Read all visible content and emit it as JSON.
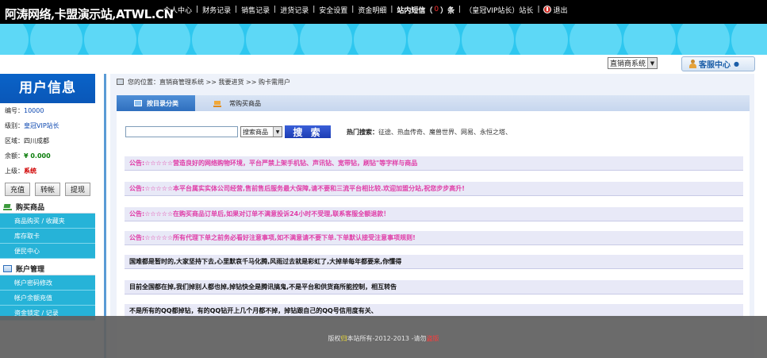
{
  "header": {
    "site_title_cn": "阿涛网络,卡盟演示站,",
    "site_title_en": "ATWL.CN",
    "nav": [
      {
        "label": "个人中心"
      },
      {
        "label": "财务记录"
      },
      {
        "label": "销售记录"
      },
      {
        "label": "进货记录"
      },
      {
        "label": "安全设置"
      },
      {
        "label": "资金明细"
      }
    ],
    "messages": {
      "prefix": "站内短信（",
      "count": "0",
      "suffix": "）条"
    },
    "user_role": "（皇冠VIP站长）站长",
    "logout": "退出"
  },
  "toolbar": {
    "system_select": "直销商系统",
    "service_center": "客服中心"
  },
  "sidebar": {
    "title": "用户信息",
    "info": {
      "id_label": "编号：",
      "id_value": "10000",
      "level_label": "级别：",
      "level_value": "皇冠VIP站长",
      "region_label": "区域：",
      "region_value": "四川成都",
      "balance_label": "余额：",
      "balance_value": "¥ 0.000",
      "parent_label": "上级：",
      "parent_value": "系统"
    },
    "buttons": {
      "recharge": "充值",
      "transfer": "转帐",
      "withdraw": "提现"
    },
    "sections": [
      {
        "title": "购买商品",
        "items": [
          "商品购买 / 收藏夹",
          "库存取卡",
          "便民中心"
        ]
      },
      {
        "title": "账户管理",
        "items": [
          "帐户密码修改",
          "帐户余额充值",
          "资金锁定 / 记录"
        ]
      }
    ]
  },
  "main": {
    "breadcrumb": "您的位置：直销商管理系统 >> 我要进货 >> 购卡需用户",
    "tabs": [
      {
        "label": "按目录分类"
      },
      {
        "label": "常购买商品"
      }
    ],
    "search": {
      "placeholder": "",
      "select_value": "搜索商品",
      "button_label": "搜 索",
      "hot_label": "热门搜索：",
      "hot_items": "征途、热血传奇、魔兽世界、网易、永恒之塔、"
    },
    "notices": [
      "公告:☆☆☆☆☆营造良好的网络购物环境，平台严禁上架手机钻、声讯钻、宽带钻，刷钻\"等字样与商品",
      "公告:☆☆☆☆☆本平台属实实体公司经营,售前售后服务最大保障,请不要和三流平台相比较.欢迎加盟分站,祝您步步高升!",
      "公告:☆☆☆☆☆在购买商品订单后,如果对订单不满意投诉24小时不受理,联系客服全额退款！",
      "公告:☆☆☆☆☆所有代理下单之前务必看好注意事项,如不满意请不要下单.下单默认接受注意事项规则!",
      "国难都是暂时的,大家坚持下去,心里默哀千马化腾,风雨过去就是彩虹了,大掉单每年都要来,你懂得",
      "目前全国都在掉,我们掉别人都也掉,掉钻快全是腾讯搞鬼,不是平台和供货商所能控制，相互转告",
      "不是所有的QQ都掉钻，有的QQ钻开上几个月都不掉，掉钻跟自己的QQ号信用度有关、"
    ]
  },
  "footer": {
    "prefix": "版权",
    "mark": "归",
    "middle": "本站所有-2012-2013 -请勿",
    "warn": "盗版"
  },
  "colors": {
    "topbar": "#000000",
    "band": "#2ec7ef",
    "sidebar_head": "#0a63c8",
    "menu_item": "#26b3d8",
    "notice_pink": "#e03ea8",
    "search_button": "#2847c4"
  }
}
